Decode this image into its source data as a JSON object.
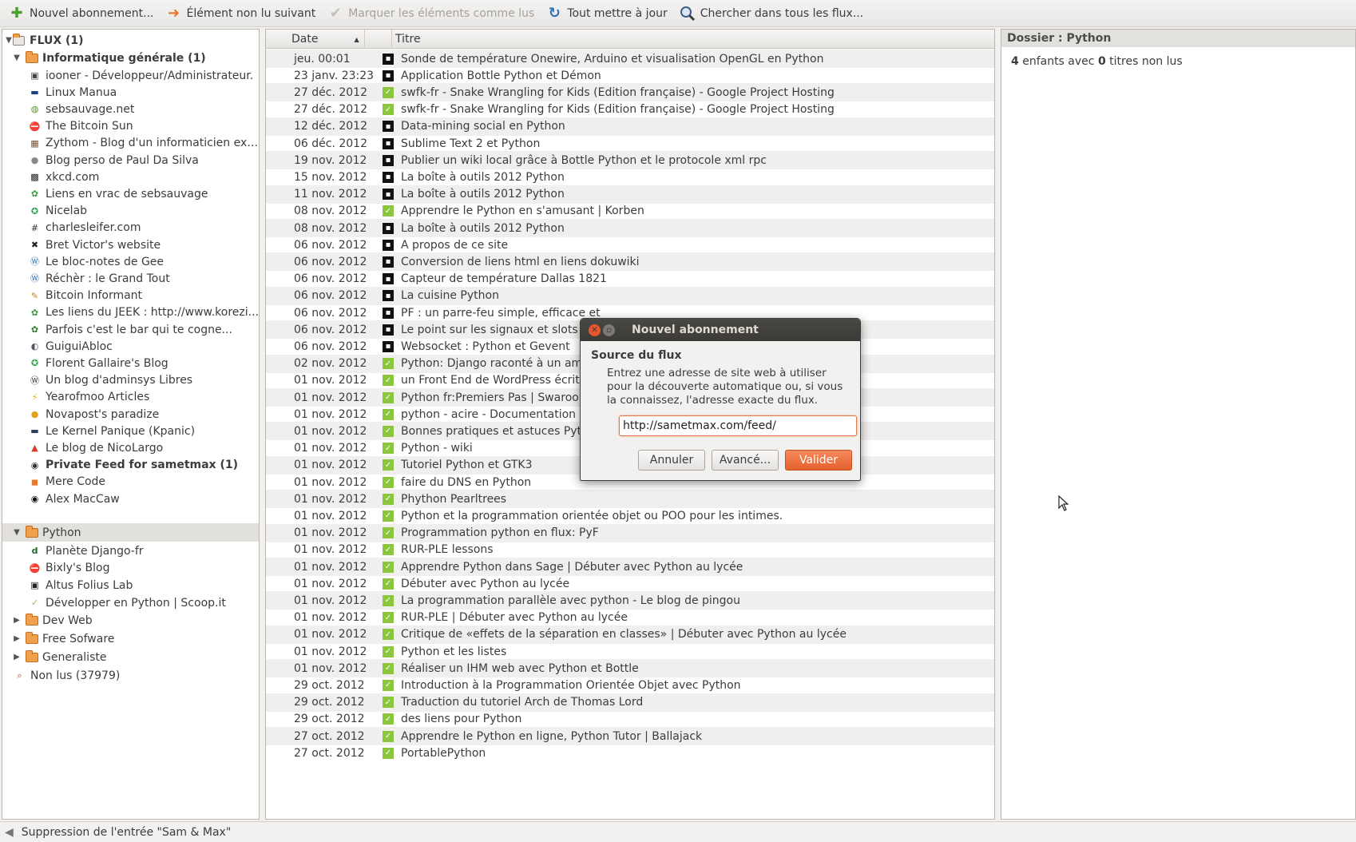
{
  "toolbar": {
    "new_sub": "Nouvel abonnement...",
    "next_unread": "Élément non lu suivant",
    "mark_read": "Marquer les éléments comme lus",
    "update_all": "Tout mettre à jour",
    "search_all": "Chercher dans tous les flux..."
  },
  "sidebar": {
    "root": "FLUX (1)",
    "folder_info": "Informatique générale (1)",
    "feeds_info": [
      "iooner - Développeur/Administrateur.",
      "Linux Manua",
      "sebsauvage.net",
      "The Bitcoin Sun",
      "Zythom - Blog d'un informaticien exp...",
      "Blog perso de Paul Da Silva",
      "xkcd.com",
      "Liens en vrac de sebsauvage",
      "Nicelab",
      "charlesleifer.com",
      "Bret Victor's website",
      "Le bloc-notes de Gee",
      "Réchèr : le Grand Tout",
      "Bitcoin Informant",
      "Les liens du JEEK : http://www.korezi...",
      "Parfois c'est le bar qui te cogne...",
      "GuiguiAbloc",
      "Florent Gallaire's Blog",
      "Un blog d'adminsys Libres",
      "Yearofmoo Articles",
      "Novapost's paradize",
      "Le Kernel Panique (Kpanic)",
      "Le blog de NicoLargo",
      "Private Feed for sametmax (1)",
      "Mere Code",
      "Alex MacCaw"
    ],
    "folder_python": "Python",
    "feeds_python": [
      "Planète Django-fr",
      "Bixly's Blog",
      "Altus Folius Lab",
      "Développer en Python | Scoop.it"
    ],
    "folder_devweb": "Dev Web",
    "folder_free": "Free Sofware",
    "folder_general": "Generaliste",
    "unread": "Non lus (37979)"
  },
  "list": {
    "col_date": "Date",
    "col_title": "Titre",
    "rows": [
      {
        "date": "jeu. 00:01",
        "title": "Sonde de température Onewire, Arduino et visualisation OpenGL en Python",
        "icon": "altus"
      },
      {
        "date": "23 janv. 23:23",
        "title": "Application Bottle Python et Démon",
        "icon": "altus"
      },
      {
        "date": "27 déc. 2012",
        "title": "swfk-fr - Snake Wrangling for Kids (Edition française) - Google Project Hosting",
        "icon": "scoop"
      },
      {
        "date": "27 déc. 2012",
        "title": "swfk-fr - Snake Wrangling for Kids (Edition française) - Google Project Hosting",
        "icon": "scoop"
      },
      {
        "date": "12 déc. 2012",
        "title": "Data-mining social en Python",
        "icon": "altus"
      },
      {
        "date": "06 déc. 2012",
        "title": "Sublime Text 2 et Python",
        "icon": "altus"
      },
      {
        "date": "19 nov. 2012",
        "title": "Publier un wiki local grâce à Bottle Python et le protocole xml rpc",
        "icon": "altus"
      },
      {
        "date": "15 nov. 2012",
        "title": "La boîte à outils 2012 Python",
        "icon": "altus"
      },
      {
        "date": "11 nov. 2012",
        "title": "La boîte à outils 2012 Python",
        "icon": "altus"
      },
      {
        "date": "08 nov. 2012",
        "title": "Apprendre le Python en s'amusant | Korben",
        "icon": "scoop"
      },
      {
        "date": "08 nov. 2012",
        "title": "La boîte à outils 2012 Python",
        "icon": "altus"
      },
      {
        "date": "06 nov. 2012",
        "title": "A propos de ce site",
        "icon": "altus"
      },
      {
        "date": "06 nov. 2012",
        "title": "Conversion de liens html en liens dokuwiki",
        "icon": "altus"
      },
      {
        "date": "06 nov. 2012",
        "title": "Capteur de température Dallas 1821",
        "icon": "altus"
      },
      {
        "date": "06 nov. 2012",
        "title": "La cuisine Python",
        "icon": "altus"
      },
      {
        "date": "06 nov. 2012",
        "title": "PF : un parre-feu simple, efficace et",
        "icon": "altus"
      },
      {
        "date": "06 nov. 2012",
        "title": "Le point sur les signaux et slots Qt",
        "icon": "altus"
      },
      {
        "date": "06 nov. 2012",
        "title": "Websocket : Python et Gevent",
        "icon": "altus"
      },
      {
        "date": "02 nov. 2012",
        "title": "Python: Django raconté à un ami",
        "icon": "scoop"
      },
      {
        "date": "01 nov. 2012",
        "title": "un Front End de WordPress écrit en",
        "icon": "scoop"
      },
      {
        "date": "01 nov. 2012",
        "title": "Python fr:Premiers Pas | Swaroop C",
        "icon": "scoop"
      },
      {
        "date": "01 nov. 2012",
        "title": "python - acire - Documentation Ubur",
        "icon": "scoop"
      },
      {
        "date": "01 nov. 2012",
        "title": "Bonnes pratiques et astuces Python",
        "icon": "scoop"
      },
      {
        "date": "01 nov. 2012",
        "title": "Python - wiki",
        "icon": "scoop"
      },
      {
        "date": "01 nov. 2012",
        "title": "Tutoriel Python et GTK3",
        "icon": "scoop"
      },
      {
        "date": "01 nov. 2012",
        "title": "faire du DNS en Python",
        "icon": "scoop"
      },
      {
        "date": "01 nov. 2012",
        "title": "Phython Pearltrees",
        "icon": "scoop"
      },
      {
        "date": "01 nov. 2012",
        "title": "Python et la programmation orientée objet ou POO pour les intimes.",
        "icon": "scoop"
      },
      {
        "date": "01 nov. 2012",
        "title": "Programmation python en flux: PyF",
        "icon": "scoop"
      },
      {
        "date": "01 nov. 2012",
        "title": "RUR-PLE lessons",
        "icon": "scoop"
      },
      {
        "date": "01 nov. 2012",
        "title": "Apprendre Python dans Sage | Débuter avec Python au lycée",
        "icon": "scoop"
      },
      {
        "date": "01 nov. 2012",
        "title": "Débuter avec Python au lycée",
        "icon": "scoop"
      },
      {
        "date": "01 nov. 2012",
        "title": "La programmation parallèle avec python - Le blog de pingou",
        "icon": "scoop"
      },
      {
        "date": "01 nov. 2012",
        "title": "RUR-PLE | Débuter avec Python au lycée",
        "icon": "scoop"
      },
      {
        "date": "01 nov. 2012",
        "title": "Critique de «effets de la séparation en classes» | Débuter avec Python au lycée",
        "icon": "scoop"
      },
      {
        "date": "01 nov. 2012",
        "title": "Python et les listes",
        "icon": "scoop"
      },
      {
        "date": "01 nov. 2012",
        "title": "Réaliser un IHM web avec Python et Bottle",
        "icon": "scoop"
      },
      {
        "date": "29 oct. 2012",
        "title": "Introduction à la Programmation Orientée Objet avec Python",
        "icon": "scoop"
      },
      {
        "date": "29 oct. 2012",
        "title": "Traduction du tutoriel Arch de Thomas Lord",
        "icon": "scoop"
      },
      {
        "date": "29 oct. 2012",
        "title": "des liens pour Python",
        "icon": "scoop"
      },
      {
        "date": "27 oct. 2012",
        "title": "Apprendre le Python en ligne, Python Tutor | Ballajack",
        "icon": "scoop"
      },
      {
        "date": "27 oct. 2012",
        "title": "PortablePython",
        "icon": "scoop"
      }
    ]
  },
  "panel": {
    "header": "Dossier : Python",
    "children_count": "4",
    "children_text": "enfants avec",
    "unread_count": "0",
    "unread_text": "titres non lus"
  },
  "dialog": {
    "title": "Nouvel abonnement",
    "section": "Source du flux",
    "description": "Entrez une adresse de site web à utiliser pour la découverte automatique ou, si vous la connaissez, l'adresse exacte du flux.",
    "url_value": "http://sametmax.com/feed/",
    "cancel": "Annuler",
    "advanced": "Avancé...",
    "ok": "Valider"
  },
  "status": {
    "text": "Suppression de l'entrée \"Sam & Max\""
  },
  "colors": {
    "accent": "#e5612b",
    "folder": "#f0a04b",
    "scoop": "#8cc63f"
  }
}
